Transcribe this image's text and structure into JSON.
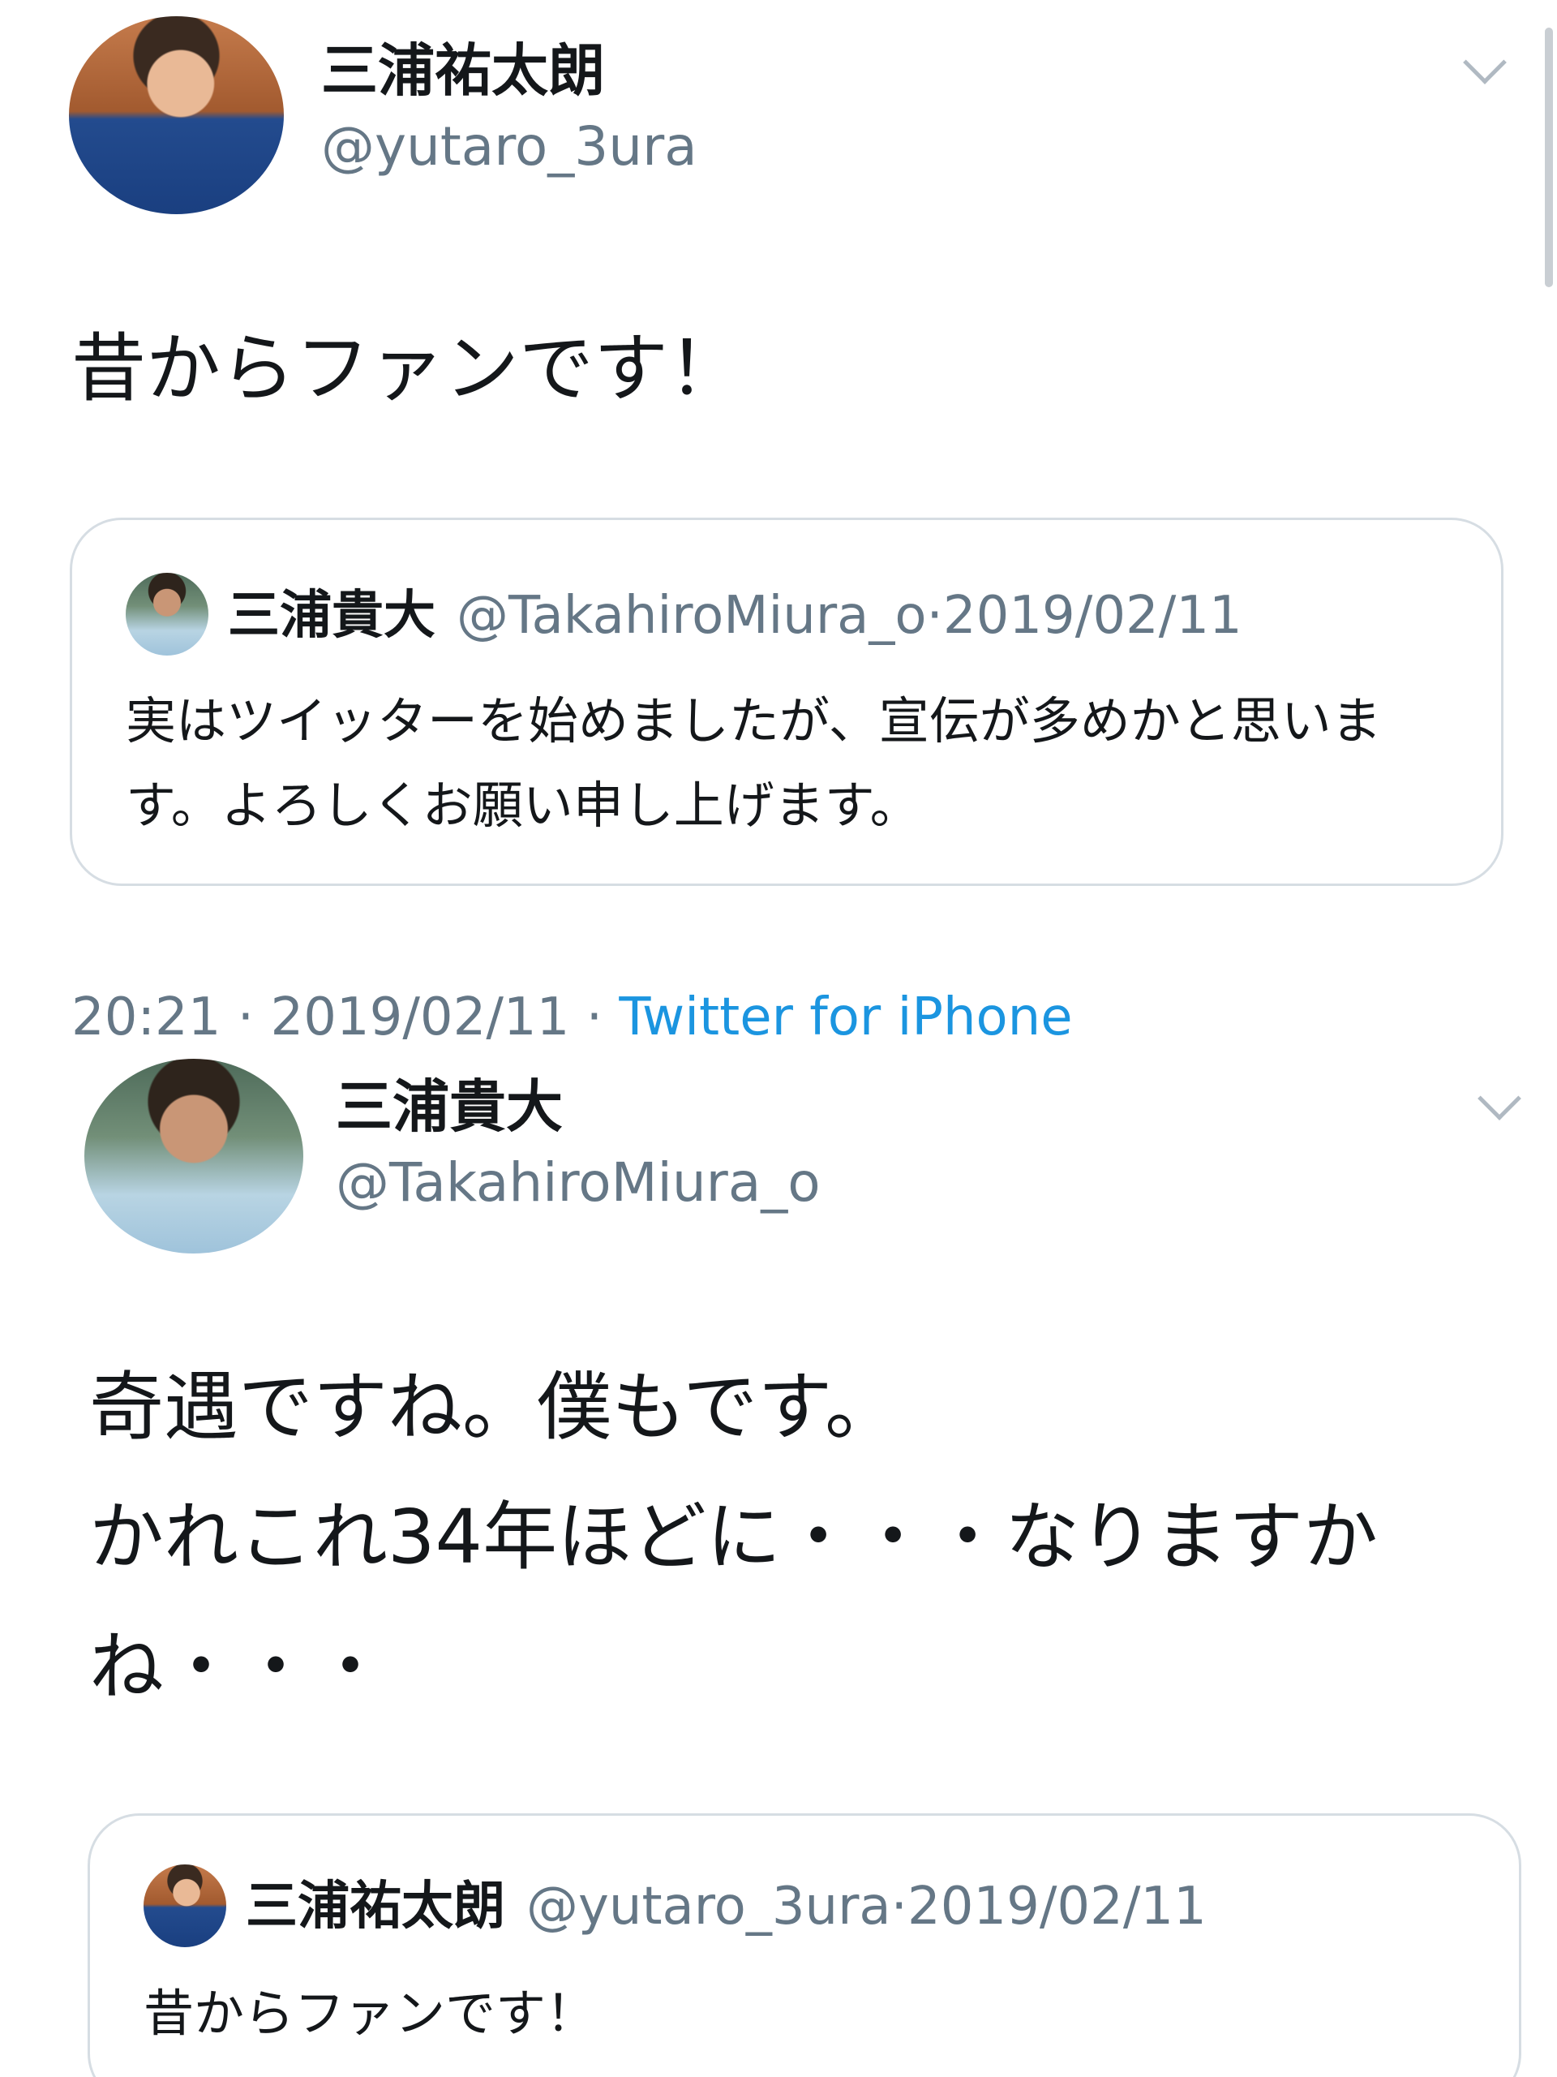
{
  "tweets": [
    {
      "display_name": "三浦祐太朗",
      "handle": "@yutaro_3ura",
      "text": "昔からファンです！",
      "quoted": {
        "display_name": "三浦貴大",
        "handle": "@TakahiroMiura_o",
        "date_sep": " · ",
        "date": "2019/02/11",
        "text": "実はツイッターを始めましたが、宣伝が多めかと思います。よろしくお願い申し上げます。"
      },
      "timestamp": "20:21 · 2019/02/11 · ",
      "source": "Twitter for iPhone"
    },
    {
      "display_name": "三浦貴大",
      "handle": "@TakahiroMiura_o",
      "text": "奇遇ですね。僕もです。\nかれこれ34年ほどに・・・なりますかね・・・",
      "quoted": {
        "display_name": "三浦祐太朗",
        "handle": "@yutaro_3ura",
        "date_sep": " · ",
        "date": "2019/02/11",
        "text": "昔からファンです！"
      }
    }
  ],
  "icons": {
    "more_menu": "chevron-down-icon"
  },
  "colors": {
    "text_primary": "#14171a",
    "text_secondary": "#657786",
    "link": "#1b95e0",
    "card_border": "#d6dde3"
  }
}
